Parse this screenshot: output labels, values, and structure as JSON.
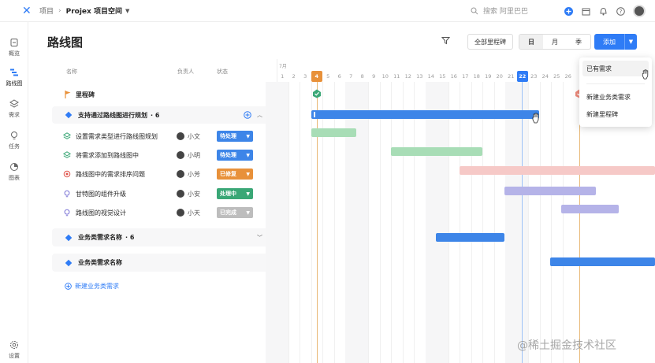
{
  "breadcrumb": {
    "project": "项目",
    "space": "Projex 项目空间"
  },
  "search": {
    "placeholder": "搜索 阿里巴巴"
  },
  "sidebar": {
    "items": [
      {
        "label": "概览",
        "icon": "overview-icon"
      },
      {
        "label": "路线图",
        "icon": "roadmap-icon"
      },
      {
        "label": "需求",
        "icon": "layers-icon"
      },
      {
        "label": "任务",
        "icon": "bulb-icon"
      },
      {
        "label": "图表",
        "icon": "chart-icon"
      },
      {
        "label": "设置",
        "icon": "gear-icon"
      }
    ]
  },
  "page": {
    "title": "路线图"
  },
  "toolbar": {
    "milestones_label": "全部里程碑",
    "views": [
      "日",
      "月",
      "季"
    ],
    "active_view": "日",
    "add_label": "添加"
  },
  "columns": {
    "name": "名称",
    "owner": "负责人",
    "status": "状态"
  },
  "milestone_row": {
    "label": "里程碑"
  },
  "groups": [
    {
      "title": "支持通过路线图进行规划",
      "count": "· 6"
    },
    {
      "title": "业务类需求名称",
      "count": "· 6"
    },
    {
      "title": "业务类需求名称",
      "count": ""
    }
  ],
  "tasks": [
    {
      "name": "设置需求类型进行路线图规划",
      "owner": "小文",
      "status": "待处理",
      "status_color": "#3d85e8",
      "icon": "layers-icon"
    },
    {
      "name": "将需求添加到路线图中",
      "owner": "小明",
      "status": "待处理",
      "status_color": "#3d85e8",
      "icon": "layers-icon"
    },
    {
      "name": "路线图中的需求排序问题",
      "owner": "小芳",
      "status": "已修复",
      "status_color": "#e8913a",
      "icon": "bug-icon"
    },
    {
      "name": "甘特图的组件升级",
      "owner": "小安",
      "status": "处理中",
      "status_color": "#3aa776",
      "icon": "bulb-icon"
    },
    {
      "name": "路线图的视觉设计",
      "owner": "小天",
      "status": "已完成",
      "status_color": "#bdbdbd",
      "icon": "bulb-icon"
    }
  ],
  "new_link": {
    "label": "新建业务类需求"
  },
  "gantt": {
    "month": "7月",
    "days": [
      "1",
      "2",
      "3",
      "4",
      "5",
      "6",
      "7",
      "8",
      "9",
      "10",
      "11",
      "12",
      "13",
      "14",
      "15",
      "16",
      "17",
      "18",
      "19",
      "20",
      "21",
      "22",
      "23",
      "24",
      "25",
      "26"
    ],
    "today": "22",
    "highlight": "4"
  },
  "dropdown": {
    "items": [
      "已有需求",
      "新建业务类需求",
      "新建里程碑"
    ]
  },
  "colors": {
    "accent": "#2f7cf6",
    "milestone_flag": "#e8913a"
  },
  "watermark": "@稀土掘金技术社区"
}
